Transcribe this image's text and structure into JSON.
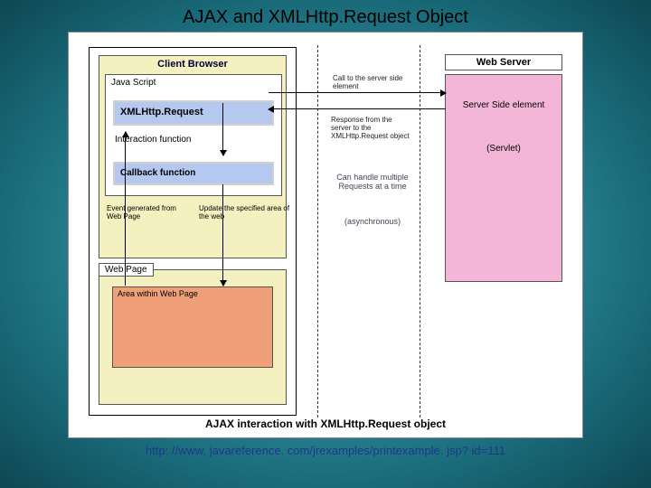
{
  "title": "AJAX and XMLHttp.Request Object",
  "url_text": "http: //www. javareference. com/jrexamples/printexample. jsp? id=111",
  "client": {
    "browser_title": "Client Browser",
    "javascript_label": "Java Script",
    "xhr_label": "XMLHttp.Request",
    "interaction_label": "Interaction function",
    "callback_label": "Callback function",
    "event_text": "Event generated from Web Page",
    "update_text": "Update  the specified area of the web",
    "webpage_label": "Web Page",
    "area_label": "Area within Web Page"
  },
  "middle": {
    "call_text": "Call to the server side element",
    "response_text": "Response from the server to the XMLHttp.Request object",
    "canhandle_text": "Can handle multiple Requests at a time",
    "async_text": "(asynchronous)"
  },
  "server": {
    "webserver_title": "Web Server",
    "server_side": "Server Side element",
    "servlet": "(Servlet)"
  },
  "caption": "AJAX interaction with XMLHttp.Request object"
}
